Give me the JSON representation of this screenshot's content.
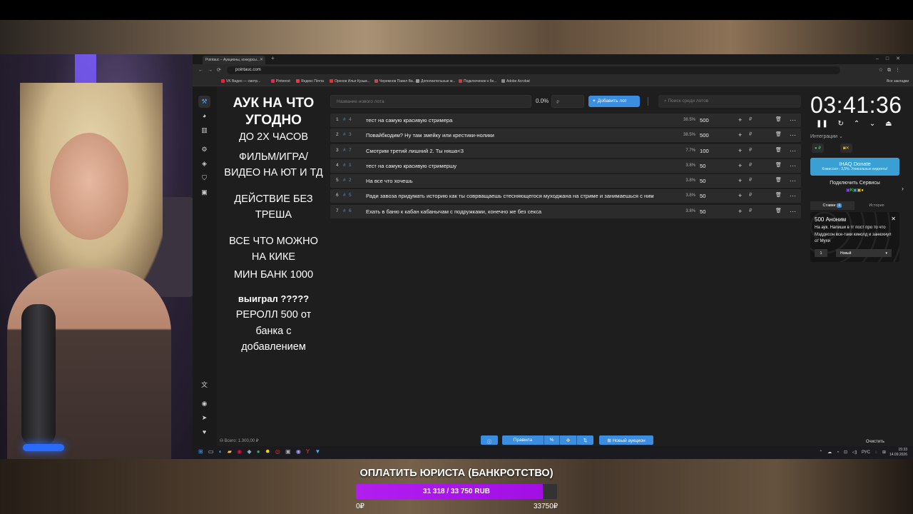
{
  "browser": {
    "tab_title": "Pointauc – Аукционы, конкурсы...",
    "url": "pointauc.com",
    "bookmarks": [
      "VK Видео — смотр...",
      "Pinterest",
      "Яндекс Почта",
      "Орехов Илья Кузьм...",
      "Черемнов Павел Ва...",
      "Дополнительные м...",
      "Подключение к бе...",
      "Adobe Acrobat"
    ],
    "bookmarks_right": "Все закладки"
  },
  "rules": {
    "title": "АУК НА ЧТО УГОДНО",
    "lines": [
      "ДО 2Х ЧАСОВ",
      "ФИЛЬМ/ИГРА/",
      "ВИДЕО НА ЮТ И ТД",
      "ДЕЙСТВИЕ БЕЗ",
      "ТРЕША",
      "ВСЕ ЧТО МОЖНО",
      "НА КИКЕ",
      "МИН БАНК 1000"
    ],
    "won": "выиграл ?????",
    "reroll": [
      "РЕРОЛЛ 500 от",
      "банка с",
      "добавлением"
    ]
  },
  "toolbar": {
    "lot_placeholder": "Название нового лота",
    "percent": "0.0%",
    "amount_placeholder": "₽",
    "add_label": "Добавить лот",
    "search_placeholder": "Поиск среди лотов"
  },
  "lots": [
    {
      "num": "1",
      "id": "4",
      "name": "тест на самую красивую стримера",
      "percent": "38.5%",
      "sum": "500"
    },
    {
      "num": "2",
      "id": "3",
      "name": "Повайбкодим? Ну там змейку или крестики-нолики",
      "percent": "38.5%",
      "sum": "500"
    },
    {
      "num": "3",
      "id": "7",
      "name": "Смотрим третий лишний 2. Ты няша<3",
      "percent": "7.7%",
      "sum": "100"
    },
    {
      "num": "4",
      "id": "1",
      "name": "тест на самую красивую стримершу",
      "percent": "3.8%",
      "sum": "50"
    },
    {
      "num": "5",
      "id": "2",
      "name": "На все что хочешь",
      "percent": "3.8%",
      "sum": "50"
    },
    {
      "num": "6",
      "id": "5",
      "name": "Ради завоза придумать историю как ты соврващаешь стесняющегося муходжана на стриме и занимаешься с ним",
      "percent": "3.8%",
      "sum": "50"
    },
    {
      "num": "7",
      "id": "6",
      "name": "Ехать в баню к кабан кабанычам с подружками, конечно же без секса",
      "percent": "3.8%",
      "sum": "50"
    }
  ],
  "timer": {
    "value": "03:41:36",
    "integrations_label": "Интеграции",
    "donate_title": "IHAQ Donate",
    "donate_sub": "Комиссия - 3,5%. Уникальные виджеты!",
    "connect_label": "Подключить Сервисы",
    "tab_bets": "Ставки",
    "tab_bets_count": "1",
    "tab_history": "История",
    "bet_author": "500 Аноним",
    "bet_message": "На аук. Напиши в тг пост про то что Мэддисон все-таки кинолд и занюхнул от Мухи",
    "bet_qty": "1",
    "bet_target": "Новый"
  },
  "bottom": {
    "total": "Всего: 1.300,00 ₽",
    "rules_label": "Правила",
    "new_auction_label": "Новый аукцион",
    "clear_label": "Очистить"
  },
  "taskbar": {
    "lang": "РУС",
    "time": "15:33",
    "date": "14.09.2026"
  },
  "goal": {
    "title": "ОПЛАТИТЬ ЮРИСТА (БАНКРОТСТВО)",
    "progress_text": "31 318 / 33 750 RUB",
    "progress_fraction": 0.928,
    "min_label": "0₽",
    "max_label": "33750₽"
  }
}
